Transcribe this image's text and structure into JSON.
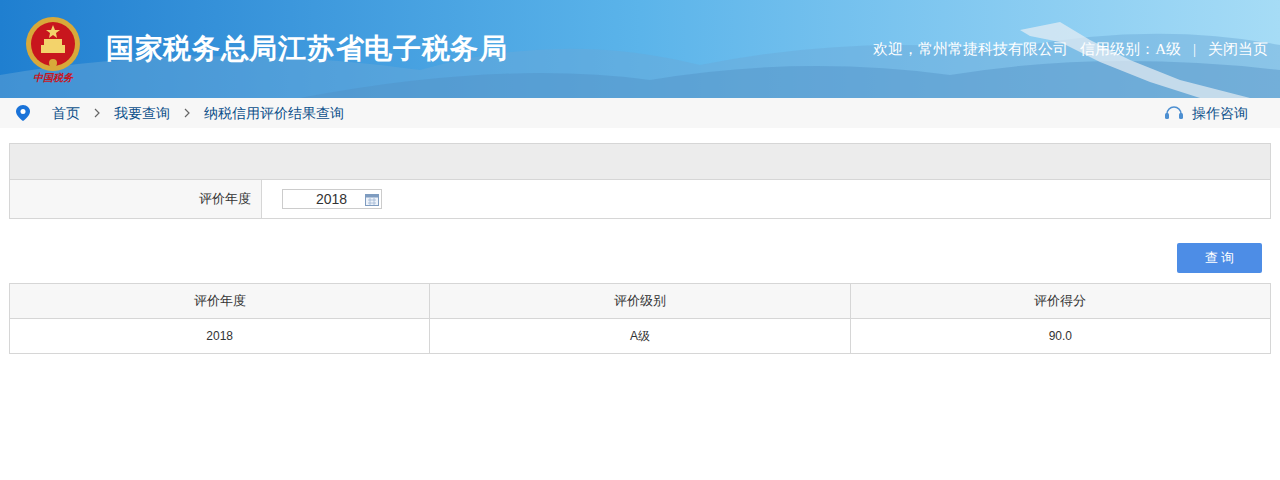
{
  "header": {
    "logo_text": "中国税务",
    "title": "国家税务总局江苏省电子税务局",
    "welcome": "欢迎，常州常捷科技有限公司",
    "credit": "信用级别：A级",
    "separator": "|",
    "close": "关闭当页"
  },
  "breadcrumb": {
    "items": [
      "首页",
      "我要查询",
      "纳税信用评价结果查询"
    ],
    "help": "操作咨询"
  },
  "form": {
    "fields": [
      {
        "label": "评价年度",
        "value": "2018"
      }
    ]
  },
  "query_button": "查 询",
  "table": {
    "columns": [
      "评价年度",
      "评价级别",
      "评价得分"
    ],
    "rows": [
      [
        "2018",
        "A级",
        "90.0"
      ]
    ]
  }
}
